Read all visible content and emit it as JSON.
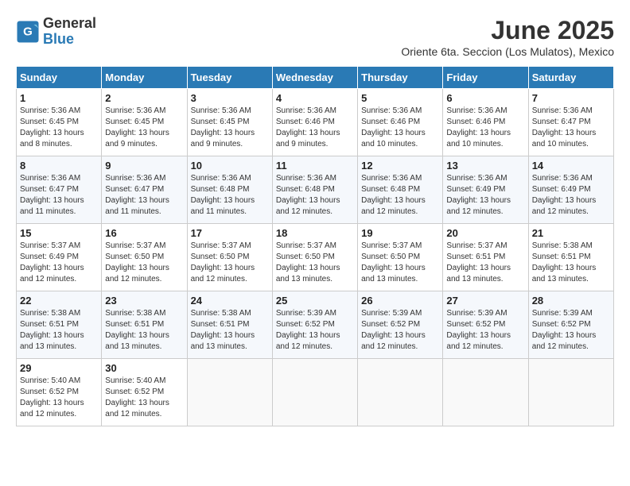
{
  "header": {
    "logo_general": "General",
    "logo_blue": "Blue",
    "month_title": "June 2025",
    "location": "Oriente 6ta. Seccion (Los Mulatos), Mexico"
  },
  "weekdays": [
    "Sunday",
    "Monday",
    "Tuesday",
    "Wednesday",
    "Thursday",
    "Friday",
    "Saturday"
  ],
  "days": [
    {
      "day": 1,
      "sunrise": "5:36 AM",
      "sunset": "6:45 PM",
      "daylight": "13 hours and 8 minutes."
    },
    {
      "day": 2,
      "sunrise": "5:36 AM",
      "sunset": "6:45 PM",
      "daylight": "13 hours and 9 minutes."
    },
    {
      "day": 3,
      "sunrise": "5:36 AM",
      "sunset": "6:45 PM",
      "daylight": "13 hours and 9 minutes."
    },
    {
      "day": 4,
      "sunrise": "5:36 AM",
      "sunset": "6:46 PM",
      "daylight": "13 hours and 9 minutes."
    },
    {
      "day": 5,
      "sunrise": "5:36 AM",
      "sunset": "6:46 PM",
      "daylight": "13 hours and 10 minutes."
    },
    {
      "day": 6,
      "sunrise": "5:36 AM",
      "sunset": "6:46 PM",
      "daylight": "13 hours and 10 minutes."
    },
    {
      "day": 7,
      "sunrise": "5:36 AM",
      "sunset": "6:47 PM",
      "daylight": "13 hours and 10 minutes."
    },
    {
      "day": 8,
      "sunrise": "5:36 AM",
      "sunset": "6:47 PM",
      "daylight": "13 hours and 11 minutes."
    },
    {
      "day": 9,
      "sunrise": "5:36 AM",
      "sunset": "6:47 PM",
      "daylight": "13 hours and 11 minutes."
    },
    {
      "day": 10,
      "sunrise": "5:36 AM",
      "sunset": "6:48 PM",
      "daylight": "13 hours and 11 minutes."
    },
    {
      "day": 11,
      "sunrise": "5:36 AM",
      "sunset": "6:48 PM",
      "daylight": "13 hours and 12 minutes."
    },
    {
      "day": 12,
      "sunrise": "5:36 AM",
      "sunset": "6:48 PM",
      "daylight": "13 hours and 12 minutes."
    },
    {
      "day": 13,
      "sunrise": "5:36 AM",
      "sunset": "6:49 PM",
      "daylight": "13 hours and 12 minutes."
    },
    {
      "day": 14,
      "sunrise": "5:36 AM",
      "sunset": "6:49 PM",
      "daylight": "13 hours and 12 minutes."
    },
    {
      "day": 15,
      "sunrise": "5:37 AM",
      "sunset": "6:49 PM",
      "daylight": "13 hours and 12 minutes."
    },
    {
      "day": 16,
      "sunrise": "5:37 AM",
      "sunset": "6:50 PM",
      "daylight": "13 hours and 12 minutes."
    },
    {
      "day": 17,
      "sunrise": "5:37 AM",
      "sunset": "6:50 PM",
      "daylight": "13 hours and 12 minutes."
    },
    {
      "day": 18,
      "sunrise": "5:37 AM",
      "sunset": "6:50 PM",
      "daylight": "13 hours and 13 minutes."
    },
    {
      "day": 19,
      "sunrise": "5:37 AM",
      "sunset": "6:50 PM",
      "daylight": "13 hours and 13 minutes."
    },
    {
      "day": 20,
      "sunrise": "5:37 AM",
      "sunset": "6:51 PM",
      "daylight": "13 hours and 13 minutes."
    },
    {
      "day": 21,
      "sunrise": "5:38 AM",
      "sunset": "6:51 PM",
      "daylight": "13 hours and 13 minutes."
    },
    {
      "day": 22,
      "sunrise": "5:38 AM",
      "sunset": "6:51 PM",
      "daylight": "13 hours and 13 minutes."
    },
    {
      "day": 23,
      "sunrise": "5:38 AM",
      "sunset": "6:51 PM",
      "daylight": "13 hours and 13 minutes."
    },
    {
      "day": 24,
      "sunrise": "5:38 AM",
      "sunset": "6:51 PM",
      "daylight": "13 hours and 13 minutes."
    },
    {
      "day": 25,
      "sunrise": "5:39 AM",
      "sunset": "6:52 PM",
      "daylight": "13 hours and 12 minutes."
    },
    {
      "day": 26,
      "sunrise": "5:39 AM",
      "sunset": "6:52 PM",
      "daylight": "13 hours and 12 minutes."
    },
    {
      "day": 27,
      "sunrise": "5:39 AM",
      "sunset": "6:52 PM",
      "daylight": "13 hours and 12 minutes."
    },
    {
      "day": 28,
      "sunrise": "5:39 AM",
      "sunset": "6:52 PM",
      "daylight": "13 hours and 12 minutes."
    },
    {
      "day": 29,
      "sunrise": "5:40 AM",
      "sunset": "6:52 PM",
      "daylight": "13 hours and 12 minutes."
    },
    {
      "day": 30,
      "sunrise": "5:40 AM",
      "sunset": "6:52 PM",
      "daylight": "13 hours and 12 minutes."
    }
  ],
  "labels": {
    "sunrise": "Sunrise:",
    "sunset": "Sunset:",
    "daylight": "Daylight:"
  }
}
